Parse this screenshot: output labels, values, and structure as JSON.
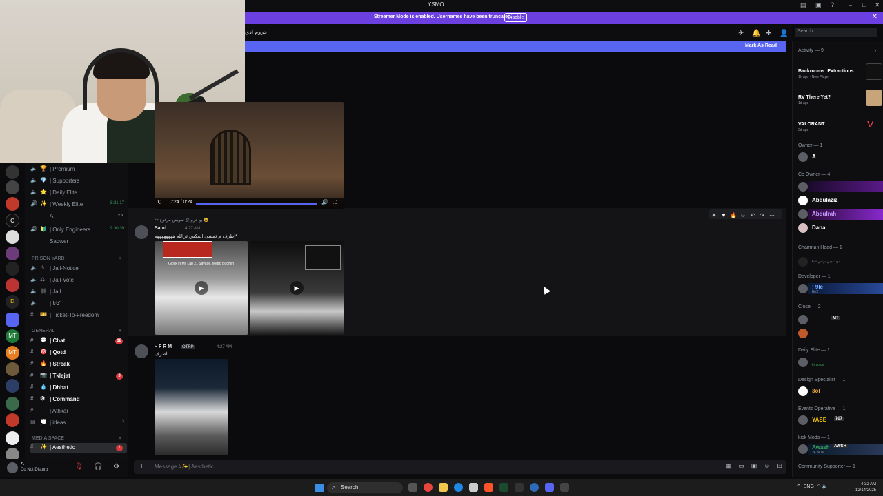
{
  "window": {
    "title": "YSMO"
  },
  "banner": {
    "text": "Streamer Mode is enabled. Usernames have been truncated.",
    "disable_label": "Disable"
  },
  "channel_header": {
    "name": "جروم ادي"
  },
  "search": {
    "placeholder": "Search"
  },
  "mark_read": {
    "label": "Mark As Read"
  },
  "servers": [
    "C",
    "MT",
    "MT",
    "7"
  ],
  "channels": {
    "top_items": [
      {
        "emoji": "🏆",
        "label": "| Premium"
      },
      {
        "emoji": "💎",
        "label": "| Supporters"
      },
      {
        "emoji": "⭐",
        "label": "| Daily Elite"
      },
      {
        "emoji": "✨",
        "label": "| Weekly Elite",
        "right": "8:21:17"
      },
      {
        "emoji": "",
        "label": "A"
      },
      {
        "emoji": "🔰",
        "label": "| Only Engineers",
        "right": "9:30:39"
      },
      {
        "emoji": "",
        "label": "Saqwer"
      }
    ],
    "prison_category": "PRISON YARD",
    "prison_items": [
      {
        "emoji": "⚠",
        "label": "| Jail-Notice"
      },
      {
        "emoji": "⚖",
        "label": "| Jail-Vote"
      },
      {
        "emoji": "⛓",
        "label": "| Jail"
      },
      {
        "emoji": "",
        "label": "| كاتا"
      },
      {
        "emoji": "🎫",
        "label": "| Ticket-To-Freedom"
      }
    ],
    "general_category": "GENERAL",
    "general_items": [
      {
        "emoji": "💬",
        "label": "| Chat",
        "badge": "18"
      },
      {
        "emoji": "🎯",
        "label": "| Qotd"
      },
      {
        "emoji": "🔥",
        "label": "| Streak"
      },
      {
        "emoji": "📷",
        "label": "| Tklejat",
        "badge": "3"
      },
      {
        "emoji": "💧",
        "label": "| Dhbat"
      },
      {
        "emoji": "⚙",
        "label": "| Command"
      },
      {
        "emoji": "",
        "label": "| Athkar"
      },
      {
        "emoji": "💭",
        "label": "| ideas",
        "right": "3"
      }
    ],
    "media_category": "MEDIA SPACE",
    "media_items": [
      {
        "emoji": "✨",
        "label": "| Aesthetic",
        "badge": "1"
      }
    ]
  },
  "user_panel": {
    "name": "A",
    "status": "Do Not Disturb"
  },
  "video": {
    "time": "0:24 / 0:24"
  },
  "messages": [
    {
      "reply": "↪ يو حرم @ سويش مرفوع 😂",
      "name": "Saud",
      "time": "4:27 AM",
      "text": "اطرف م تمشي الفكس ترالله ههههههههه*",
      "img1_caption": "Glock in My Lap\n21 Savage, Metro Boomin"
    },
    {
      "name": "~ F R M",
      "tag": "OTRP",
      "time": "4:27 AM",
      "text": "اطرف"
    }
  ],
  "composer": {
    "placeholder": "Message #✨| Aesthetic"
  },
  "right": {
    "activity_header": "Activity — 9",
    "activities": [
      {
        "title": "Backrooms: Extractions",
        "sub": "1h ago · New Player"
      },
      {
        "title": "RV There Yet?",
        "sub": "1d ago"
      },
      {
        "title": "VALORANT",
        "sub": "2d ago"
      }
    ],
    "owner_header": "Owner — 1",
    "owner": "A",
    "coowner_header": "Co Owner — 4",
    "coowners": [
      "Abdulaziz",
      "Abdulrah",
      "Dana"
    ],
    "chairman_header": "Chairman Head — 1",
    "chairman_sub": "موت مين برنس ناما",
    "developer_header": "Developer — 1",
    "developer": "! 9lc",
    "developer_sub": "Ne2",
    "close_header": "Close — 2",
    "close_tag": "MT",
    "daily_header": "Daily Elite — 1",
    "daily_sub": "In voice",
    "design_header": "Design Specialist — 1",
    "design": "3oF",
    "events_header": "Events Operative — 1",
    "events": "YASE",
    "events_tag": "707",
    "kick_header": "kick Mods — 1",
    "kick": "Awash",
    "kick_tag": "AWSH",
    "kick_sub": "24 NOV",
    "community_header": "Community Supporter — 1"
  },
  "taskbar": {
    "search": "Search",
    "lang": "ENG",
    "time": "4:32 AM",
    "date": "12/14/2025"
  }
}
